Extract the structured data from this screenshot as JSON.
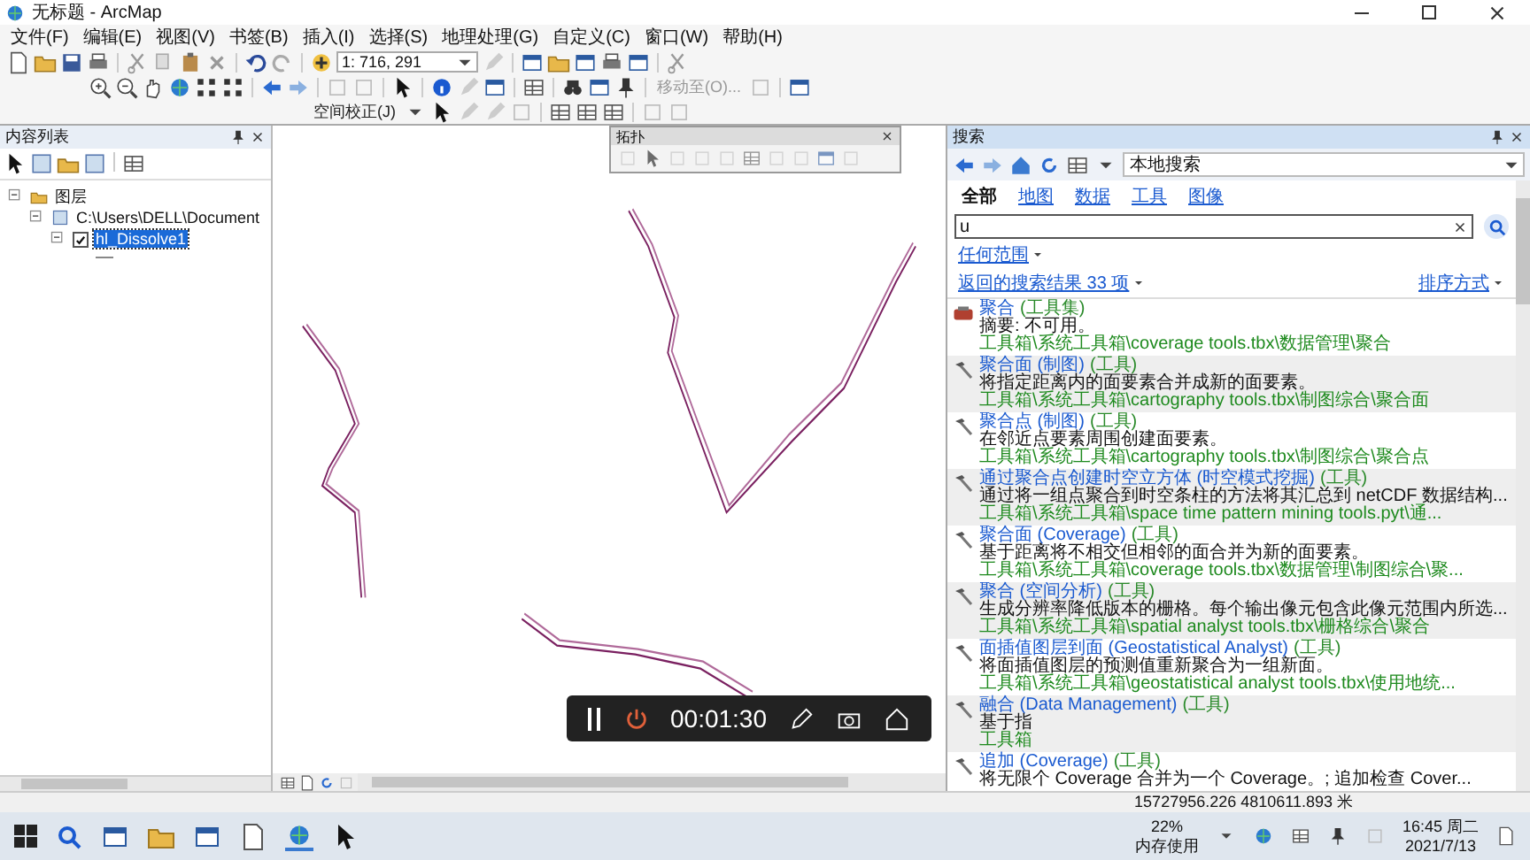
{
  "window": {
    "title": "无标题 - ArcMap"
  },
  "menu": [
    "文件(F)",
    "编辑(E)",
    "视图(V)",
    "书签(B)",
    "插入(I)",
    "选择(S)",
    "地理处理(G)",
    "自定义(C)",
    "窗口(W)",
    "帮助(H)"
  ],
  "toolbar": {
    "scale": "1: 716, 291",
    "move_to": "移动至(O)...",
    "spatial_adjust": "空间校正(J)"
  },
  "toc": {
    "title": "内容列表",
    "tree": [
      {
        "label": "图层",
        "expanded": true,
        "children": [
          {
            "label": "C:\\Users\\DELL\\Document",
            "expanded": true,
            "children": [
              {
                "label": "hl_Dissolve1",
                "checked": true,
                "selected": true
              }
            ]
          }
        ]
      }
    ]
  },
  "topology_toolbar": {
    "title": "拓扑"
  },
  "search": {
    "title": "搜索",
    "scope": "本地搜索",
    "tabs": [
      {
        "label": "全部",
        "selected": true
      },
      {
        "label": "地图",
        "selected": false
      },
      {
        "label": "数据",
        "selected": false
      },
      {
        "label": "工具",
        "selected": false
      },
      {
        "label": "图像",
        "selected": false
      }
    ],
    "query": "u",
    "extent": "任何范围",
    "count": "返回的搜索结果 33 项",
    "sort": "排序方式",
    "results": [
      {
        "kind": "toolset",
        "title": "聚合",
        "type": "(工具集)",
        "summary": "摘要: 不可用。",
        "path": "工具箱\\系统工具箱\\coverage tools.tbx\\数据管理\\聚合"
      },
      {
        "kind": "tool",
        "title": "聚合面 (制图)",
        "type": "(工具)",
        "summary": "将指定距离内的面要素合并成新的面要素。",
        "path": "工具箱\\系统工具箱\\cartography tools.tbx\\制图综合\\聚合面"
      },
      {
        "kind": "tool",
        "title": "聚合点 (制图)",
        "type": "(工具)",
        "summary": "在邻近点要素周围创建面要素。",
        "path": "工具箱\\系统工具箱\\cartography tools.tbx\\制图综合\\聚合点"
      },
      {
        "kind": "tool",
        "title": "通过聚合点创建时空立方体 (时空模式挖掘)",
        "type": "(工具)",
        "summary": "通过将一组点聚合到时空条柱的方法将其汇总到 netCDF 数据结构...",
        "path": "工具箱\\系统工具箱\\space time pattern mining tools.pyt\\通..."
      },
      {
        "kind": "tool",
        "title": "聚合面 (Coverage)",
        "type": "(工具)",
        "summary": "基于距离将不相交但相邻的面合并为新的面要素。",
        "path": "工具箱\\系统工具箱\\coverage tools.tbx\\数据管理\\制图综合\\聚..."
      },
      {
        "kind": "tool",
        "title": "聚合 (空间分析)",
        "type": "(工具)",
        "summary": "生成分辨率降低版本的栅格。每个输出像元包含此像元范围内所选...",
        "path": "工具箱\\系统工具箱\\spatial analyst tools.tbx\\栅格综合\\聚合"
      },
      {
        "kind": "tool",
        "title": "面插值图层到面 (Geostatistical Analyst)",
        "type": "(工具)",
        "summary": "将面插值图层的预测值重新聚合为一组新面。",
        "path": "工具箱\\系统工具箱\\geostatistical analyst tools.tbx\\使用地统..."
      },
      {
        "kind": "tool",
        "title": "融合 (Data Management)",
        "type": "(工具)",
        "summary": "基于指",
        "path": "工具箱"
      },
      {
        "kind": "tool",
        "title": "追加 (Coverage)",
        "type": "(工具)",
        "summary": "将无限个 Coverage 合并为一个 Coverage。; 追加检查 Cover..."
      }
    ]
  },
  "recorder": {
    "time": "00:01:30"
  },
  "status_bar": {
    "coordinates": "15727956.226  4810611.893 米"
  },
  "taskbar": {
    "memory": "22%",
    "memory_label": "内存使用",
    "time": "16:45 周二",
    "date": "2021/7/13"
  }
}
